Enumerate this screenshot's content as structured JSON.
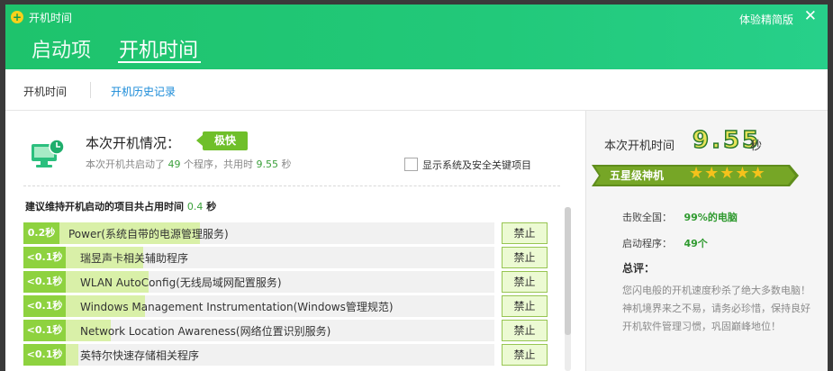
{
  "window": {
    "app_title": "开机时间",
    "lite_mode_label": "体验精简版",
    "close_glyph": "✕"
  },
  "tabs": [
    {
      "label": "启动项"
    },
    {
      "label": "开机时间"
    }
  ],
  "subnav": {
    "items": [
      {
        "label": "开机时间"
      },
      {
        "label": "开机历史记录"
      }
    ]
  },
  "boot_summary": {
    "status_label": "本次开机情况：",
    "status_badge": "极快",
    "summary_prefix": "本次开机共启动了",
    "program_count": "49",
    "summary_mid": "个程序，共用时",
    "total_time": "9.55",
    "summary_suffix": "秒",
    "show_system_label": "显示系统及安全关键项目"
  },
  "maintain": {
    "title_prefix": "建议维持开机启动的项目共占用时间",
    "time": "0.4",
    "title_suffix": "秒",
    "items": [
      {
        "time": "0.2秒",
        "name": "Power(系统自带的电源管理服务)",
        "action": "禁止"
      },
      {
        "time": "<0.1秒",
        "name": "瑞昱声卡相关辅助程序",
        "action": "禁止"
      },
      {
        "time": "<0.1秒",
        "name": "WLAN AutoConfig(无线局域网配置服务)",
        "action": "禁止"
      },
      {
        "time": "<0.1秒",
        "name": "Windows Management Instrumentation(Windows管理规范)",
        "action": "禁止"
      },
      {
        "time": "<0.1秒",
        "name": "Network Location Awareness(网络位置识别服务)",
        "action": "禁止"
      },
      {
        "time": "<0.1秒",
        "name": "英特尔快速存储相关程序",
        "action": "禁止"
      }
    ]
  },
  "side": {
    "boot_time_label": "本次开机时间",
    "boot_time_value": "9.55",
    "boot_time_unit": "秒",
    "rank_label": "五星级神机",
    "stars": "★★★★★",
    "beat_label": "击败全国：",
    "beat_value": "99%的电脑",
    "programs_label": "启动程序：",
    "programs_value": "49个",
    "comment_title": "总评：",
    "comment_text": "您闪电般的开机速度秒杀了绝大多数电脑！神机境界来之不易，请务必珍惜，保持良好开机软件管理习惯，巩固巅峰地位！"
  },
  "colors": {
    "header_green": "#22c97a",
    "progress_green": "#8ed23f",
    "badge_green": "#6fbf2a",
    "link_blue": "#1a8bd8"
  }
}
